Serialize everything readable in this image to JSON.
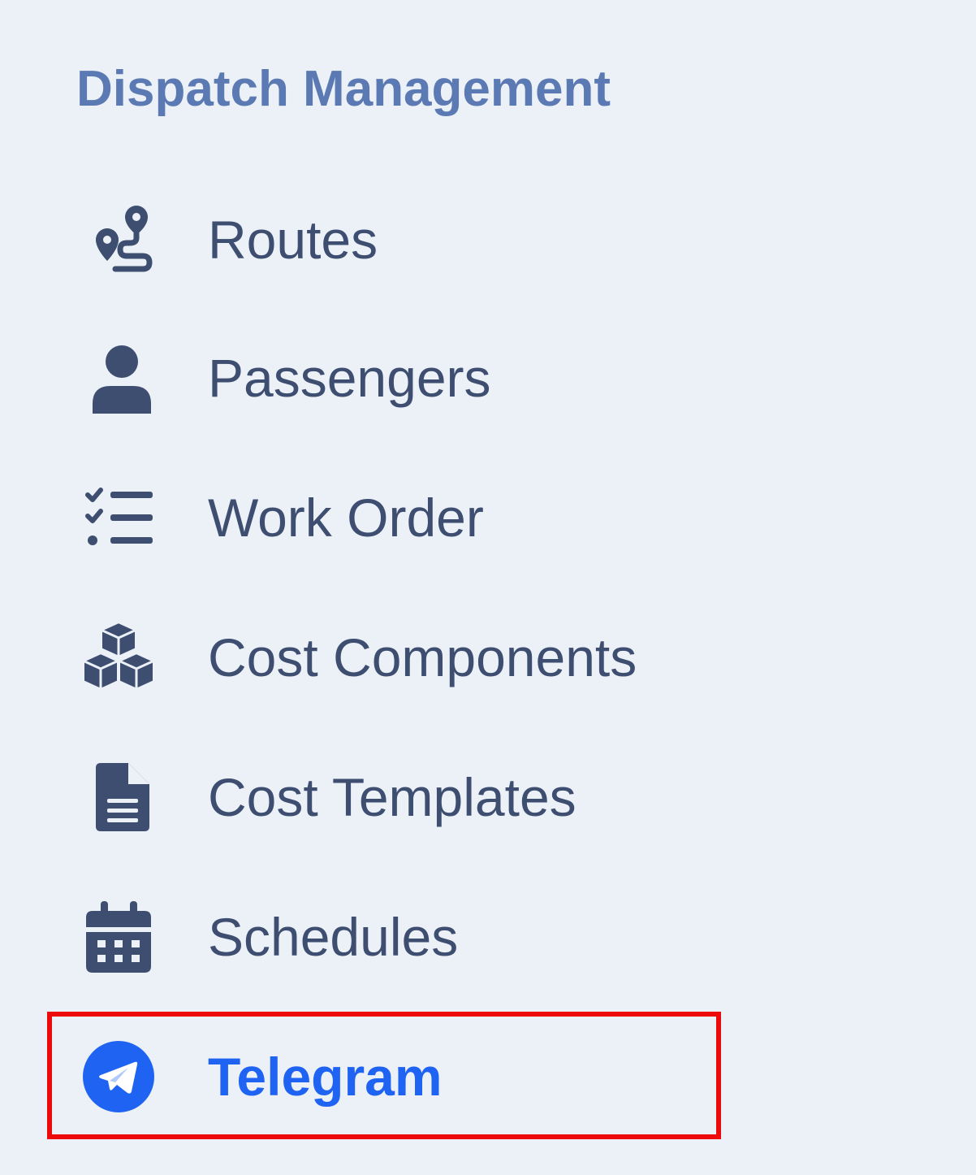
{
  "sidebar": {
    "section_title": "Dispatch Management",
    "items": [
      {
        "label": "Routes",
        "icon": "route-icon",
        "active": false
      },
      {
        "label": "Passengers",
        "icon": "user-icon",
        "active": false
      },
      {
        "label": "Work Order",
        "icon": "checklist-icon",
        "active": false
      },
      {
        "label": "Cost Components",
        "icon": "cubes-icon",
        "active": false
      },
      {
        "label": "Cost Templates",
        "icon": "file-icon",
        "active": false
      },
      {
        "label": "Schedules",
        "icon": "calendar-icon",
        "active": false
      },
      {
        "label": "Telegram",
        "icon": "telegram-icon",
        "active": true
      }
    ]
  },
  "colors": {
    "background": "#ecf0f7",
    "section_title": "#5b7ab3",
    "text": "#3e4e70",
    "active": "#1f63f2",
    "highlight_border": "#ec0a0a"
  }
}
